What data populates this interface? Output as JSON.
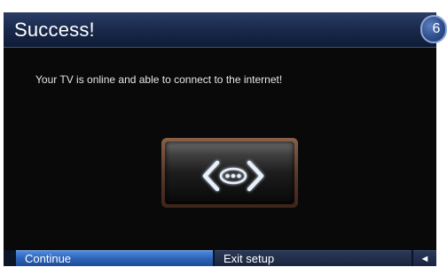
{
  "header": {
    "title": "Success!",
    "step_number": "6"
  },
  "main": {
    "message": "Your TV is online and able to connect to the internet!",
    "status_icon": "network-connected-icon"
  },
  "footer": {
    "continue_label": "Continue",
    "exit_label": "Exit setup",
    "back_glyph": "◄"
  },
  "colors": {
    "header_bg": "#1a2a4d",
    "panel_bg": "#090909",
    "selected_button": "#2c63b8",
    "tile_border": "#5a3a2b"
  }
}
